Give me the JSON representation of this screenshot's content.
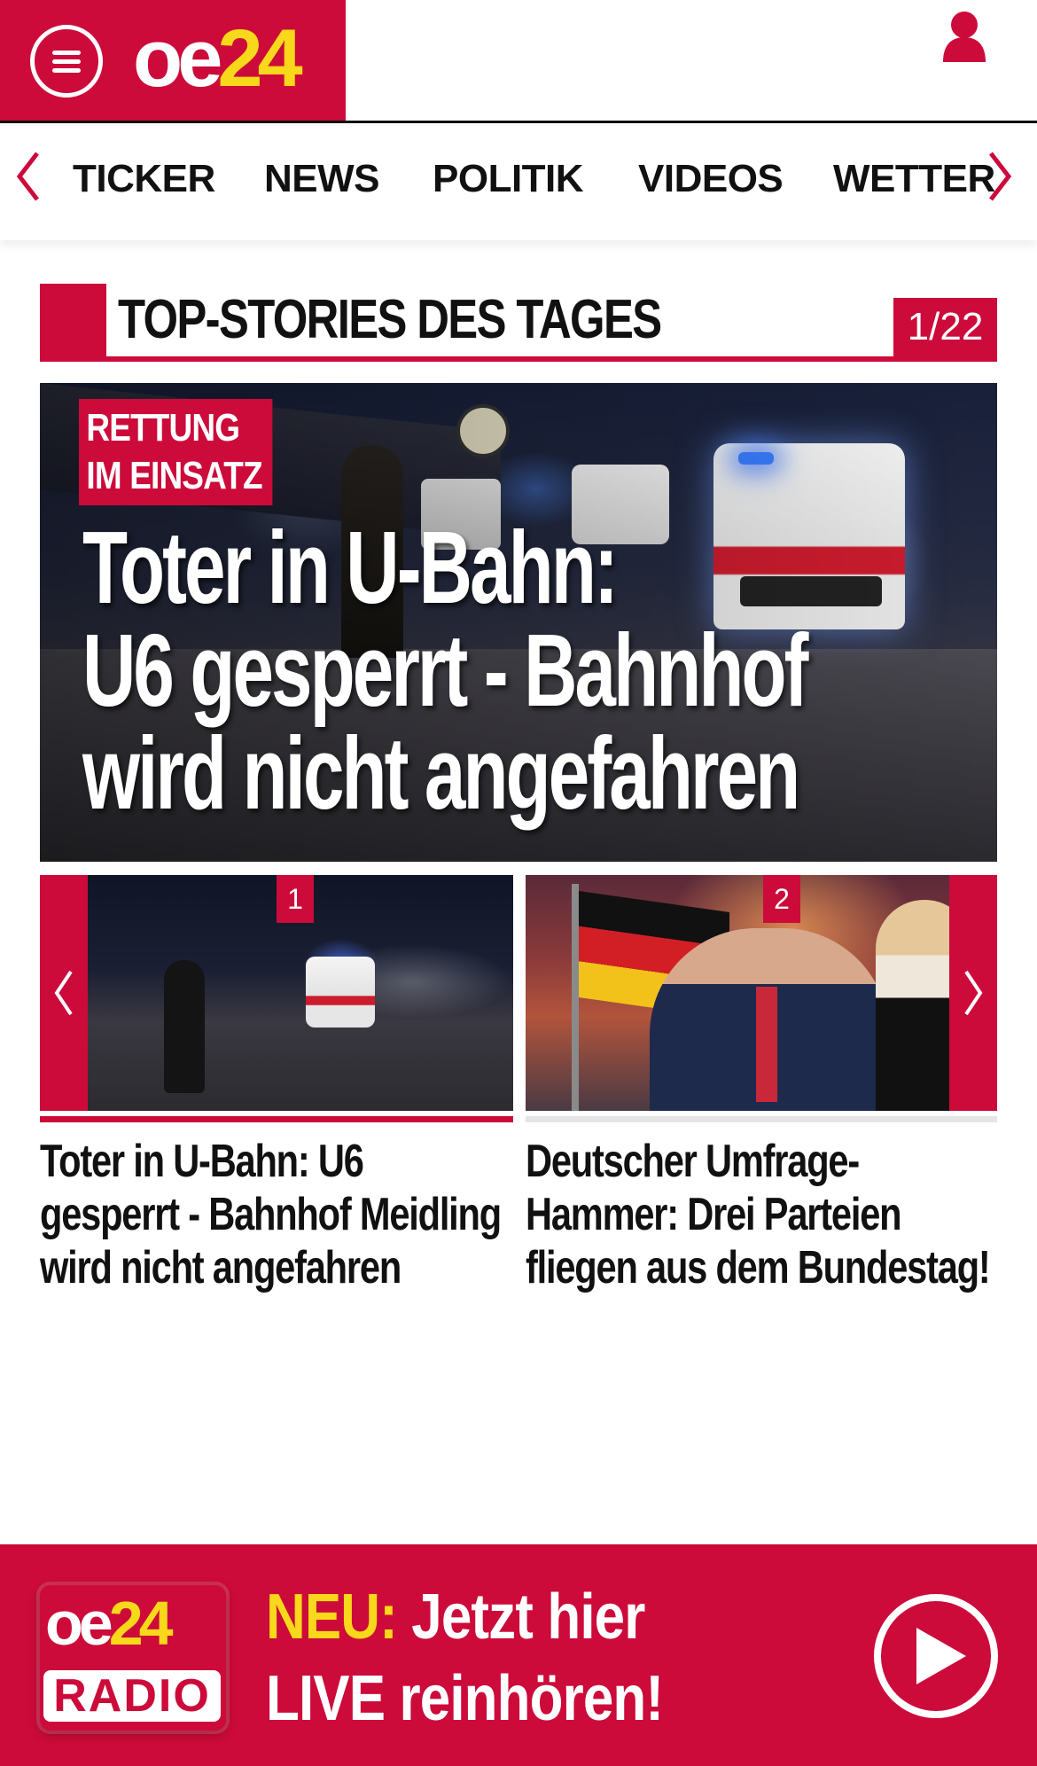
{
  "header": {
    "logo_part1": "oe",
    "logo_part2": "24",
    "icons": {
      "menu": "hamburger-menu-icon",
      "user": "user-icon"
    }
  },
  "nav": {
    "items": [
      {
        "label": "TICKER"
      },
      {
        "label": "NEWS"
      },
      {
        "label": "POLITIK"
      },
      {
        "label": "VIDEOS"
      },
      {
        "label": "WETTER"
      }
    ]
  },
  "section": {
    "title": "TOP-STORIES DES TAGES",
    "counter": "1/22"
  },
  "hero": {
    "tag_line1": "RETTUNG",
    "tag_line2": "IM EINSATZ",
    "headline_line1": "Toter in U-Bahn:",
    "headline_line2": "U6 gesperrt - Bahnhof",
    "headline_line3": "wird nicht angefahren"
  },
  "carousel": {
    "cards": [
      {
        "number": "1",
        "title_line1": "Toter in U-Bahn: U6",
        "title_line2": "gesperrt - Bahnhof Meidling",
        "title_line3": "wird nicht angefahren"
      },
      {
        "number": "2",
        "title_line1": "Deutscher Umfrage-",
        "title_line2": "Hammer: Drei Parteien",
        "title_line3": "fliegen aus dem Bundestag!"
      }
    ]
  },
  "radio": {
    "logo_part1": "oe",
    "logo_part2": "24",
    "logo_radio": "RADIO",
    "neu": "NEU:",
    "line1_rest": " Jetzt hier",
    "line2": "LIVE reinhören!"
  },
  "colors": {
    "brand_red": "#cc0b3a",
    "brand_yellow": "#f7d81a"
  }
}
